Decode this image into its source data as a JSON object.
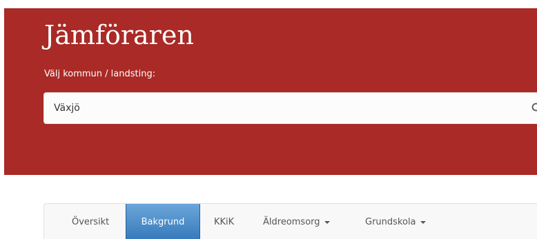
{
  "header": {
    "title": "Jämföraren",
    "select_label": "Välj kommun / landsting:"
  },
  "search": {
    "value": "Växjö",
    "icon": "search-icon"
  },
  "nav": {
    "items": [
      {
        "label": "Översikt",
        "active": false,
        "dropdown": false
      },
      {
        "label": "Bakgrund",
        "active": true,
        "dropdown": false
      },
      {
        "label": "KKiK",
        "active": false,
        "dropdown": false
      },
      {
        "label": "Äldreomsorg",
        "active": false,
        "dropdown": true
      },
      {
        "label": "Grundskola",
        "active": false,
        "dropdown": true
      }
    ]
  },
  "colors": {
    "header_bg": "#a92a26",
    "active_tab": "#2f73b6",
    "nav_bg": "#f8f8f8"
  }
}
